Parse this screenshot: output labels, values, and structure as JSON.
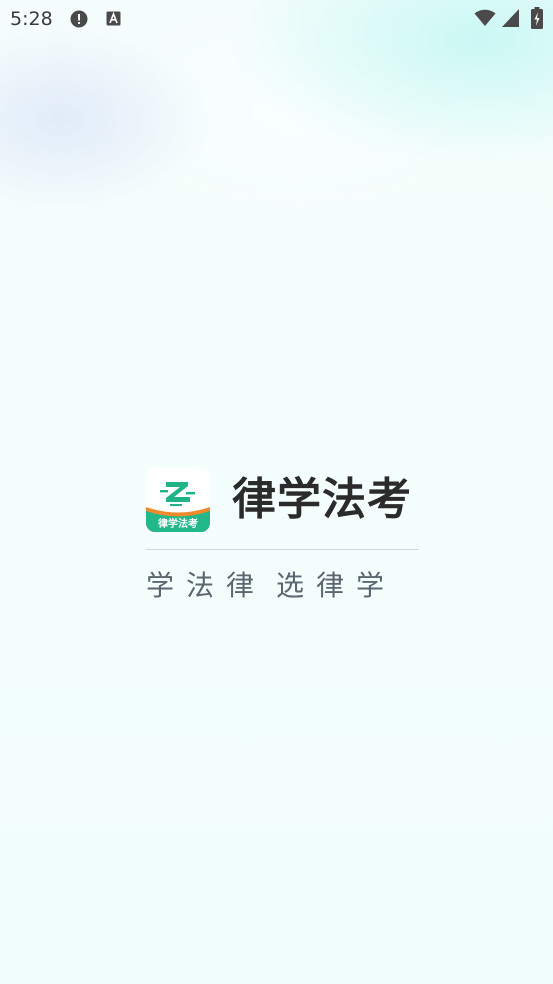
{
  "status_bar": {
    "time": "5:28",
    "icons": [
      "alert-icon",
      "a-notification-icon",
      "wifi-icon",
      "signal-icon",
      "battery-icon"
    ]
  },
  "logo": {
    "label": "律学法考",
    "colors": {
      "green": "#22b889",
      "orange": "#f08a2e",
      "tile": "#ffffff"
    }
  },
  "brand": {
    "name": "律学法考"
  },
  "slogan": {
    "left": "学法律",
    "right": "选律学"
  },
  "colors": {
    "text_dark": "#2b2b2b",
    "slogan": "#5b6670",
    "status_icon": "#3a3a3a"
  }
}
